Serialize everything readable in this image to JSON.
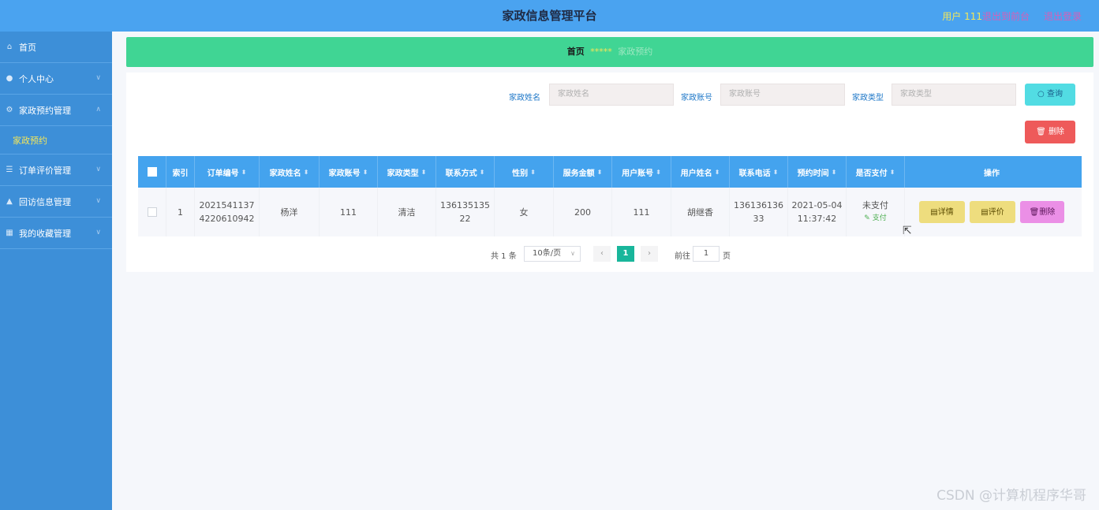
{
  "header": {
    "title": "家政信息管理平台",
    "user": "用户 111",
    "back_to_front": "退出到前台",
    "logout": "退出登录"
  },
  "sidebar": {
    "items": [
      {
        "label": "首页",
        "icon": "home-icon"
      },
      {
        "label": "个人中心",
        "icon": "user-icon"
      },
      {
        "label": "家政预约管理",
        "icon": "settings-icon"
      },
      {
        "label": "订单评价管理",
        "icon": "list-icon"
      },
      {
        "label": "回访信息管理",
        "icon": "thumb-icon"
      },
      {
        "label": "我的收藏管理",
        "icon": "grid-icon"
      }
    ],
    "submenu": "家政预约"
  },
  "breadcrumb": {
    "home": "首页",
    "stars": "*****",
    "current": "家政预约"
  },
  "search": {
    "name_label": "家政姓名",
    "name_placeholder": "家政姓名",
    "account_label": "家政账号",
    "account_placeholder": "家政账号",
    "type_label": "家政类型",
    "type_placeholder": "家政类型",
    "query_label": "查询",
    "delete_label": "删除"
  },
  "table": {
    "headers": [
      "索引",
      "订单编号",
      "家政姓名",
      "家政账号",
      "家政类型",
      "联系方式",
      "性别",
      "服务金额",
      "用户账号",
      "用户姓名",
      "联系电话",
      "预约时间",
      "是否支付",
      "操作"
    ],
    "rows": [
      {
        "index": "1",
        "order_no": "20215411374220610942",
        "order_no_l1": "2021541137",
        "order_no_l2": "4220610942",
        "name": "杨洋",
        "account": "111",
        "type": "清洁",
        "contact_l1": "136135135",
        "contact_l2": "22",
        "gender": "女",
        "amount": "200",
        "user_account": "111",
        "user_name": "胡继香",
        "phone_l1": "136136136",
        "phone_l2": "33",
        "time_l1": "2021-05-04",
        "time_l2": "11:37:42",
        "paid": "未支付",
        "pay_link": "支付",
        "actions": [
          "详情",
          "评价",
          "删除"
        ]
      }
    ]
  },
  "pager": {
    "total": "共 1 条",
    "size": "10条/页",
    "current": "1",
    "goto": "前往",
    "goto_value": "1",
    "unit": "页"
  },
  "watermark": "CSDN @计算机程序华哥"
}
